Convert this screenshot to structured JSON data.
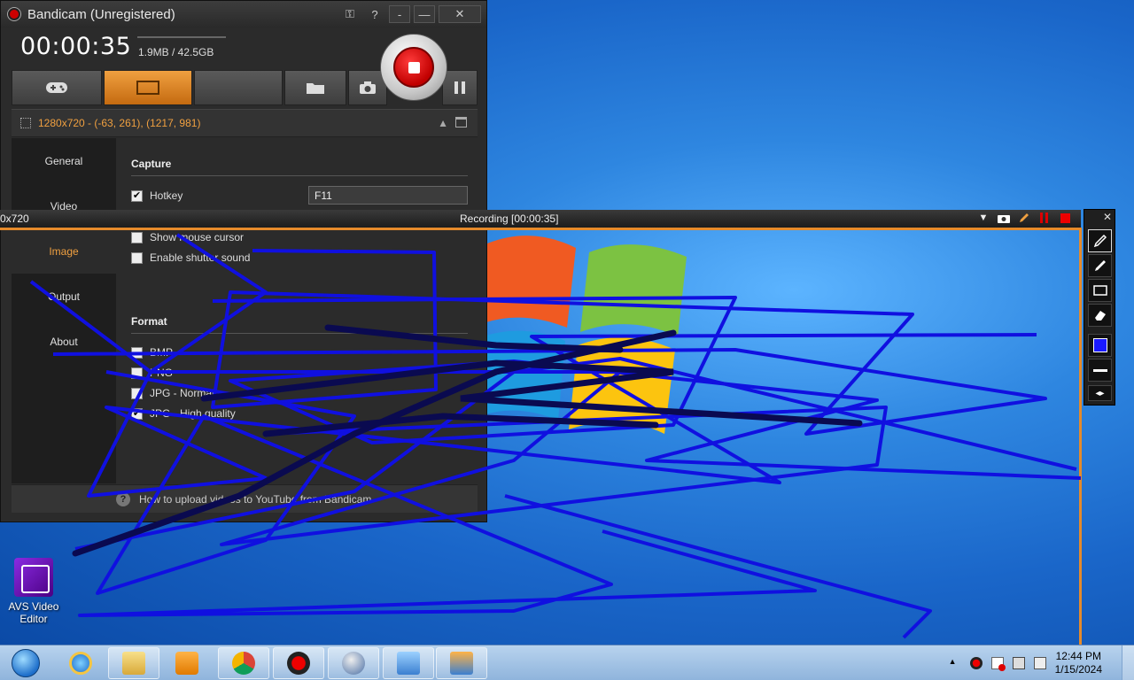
{
  "bandicam": {
    "title": "Bandicam (Unregistered)",
    "timer": "00:00:35",
    "size": "1.9MB / 42.5GB",
    "area_text": "1280x720 - (-63, 261), (1217, 981)",
    "controls": {
      "key": "⚿",
      "help": "?",
      "min": "-",
      "min2": "—",
      "close": "✕"
    },
    "sidebar": [
      {
        "label": "General"
      },
      {
        "label": "Video"
      },
      {
        "label": "Image"
      },
      {
        "label": "Output"
      },
      {
        "label": "About"
      }
    ],
    "capture_title": "Capture",
    "hotkey_label": "Hotkey",
    "hotkey_value": "F11",
    "show_cursor_label": "Show mouse cursor",
    "shutter_label": "Enable shutter sound",
    "format_title": "Format",
    "formats": [
      {
        "label": "BMP",
        "checked": false
      },
      {
        "label": "PNG",
        "checked": false
      },
      {
        "label": "JPG - Normal",
        "checked": false
      },
      {
        "label": "JPG - High quality",
        "checked": true
      }
    ],
    "footer_text": "How to upload videos to YouTube from Bandicam",
    "accent": "#f0a040"
  },
  "recording_bar": {
    "size_label": "0x720",
    "title": "Recording [00:00:35]"
  },
  "desktop": {
    "icon_label": "AVS Video Editor"
  },
  "taskbar": {
    "time": "12:44 PM",
    "date": "1/15/2024"
  }
}
